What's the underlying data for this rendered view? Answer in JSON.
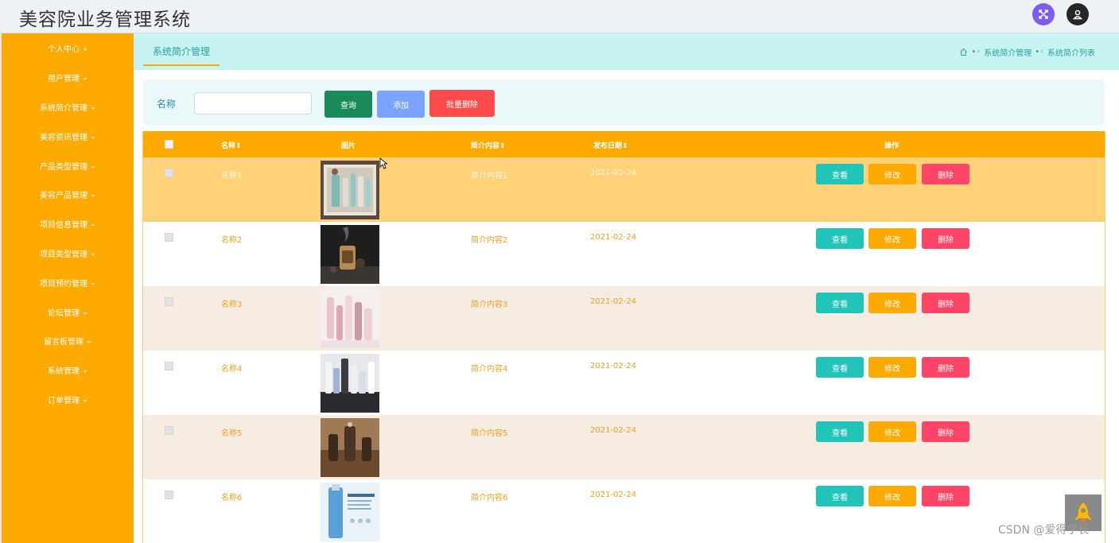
{
  "app": {
    "title": "美容院业务管理系统"
  },
  "header": {
    "icons": [
      "expand-icon",
      "user-avatar-icon"
    ]
  },
  "sidebar": {
    "items": [
      {
        "label": "个人中心"
      },
      {
        "label": "用户管理"
      },
      {
        "label": "系统简介管理"
      },
      {
        "label": "美容资讯管理"
      },
      {
        "label": "产品类型管理"
      },
      {
        "label": "美容产品管理"
      },
      {
        "label": "项目信息管理"
      },
      {
        "label": "项目类型管理"
      },
      {
        "label": "项目预约管理"
      },
      {
        "label": "论坛管理"
      },
      {
        "label": "留言板管理"
      },
      {
        "label": "系统管理"
      },
      {
        "label": "订单管理"
      }
    ]
  },
  "breadcrumb": {
    "tab": "系统简介管理",
    "path": [
      "系统简介管理",
      "系统简介列表"
    ]
  },
  "search": {
    "label": "名称",
    "value": "",
    "query_btn": "查询",
    "add_btn": "添加",
    "batch_delete_btn": "批量删除"
  },
  "table": {
    "headers": {
      "name": "名称",
      "image": "图片",
      "content": "简介内容",
      "date": "发布日期",
      "actions": "操作"
    },
    "sort_glyph": "⇕",
    "rows": [
      {
        "name": "名称1",
        "content": "简介内容1",
        "date": "2021-02-24",
        "image": "cosmetics-tray"
      },
      {
        "name": "名称2",
        "content": "简介内容2",
        "date": "2021-02-24",
        "image": "aroma-diffuser"
      },
      {
        "name": "名称3",
        "content": "简介内容3",
        "date": "2021-02-24",
        "image": "pink-bottles"
      },
      {
        "name": "名称4",
        "content": "简介内容4",
        "date": "2021-02-24",
        "image": "skincare-set"
      },
      {
        "name": "名称5",
        "content": "简介内容5",
        "date": "2021-02-24",
        "image": "wooden-diffusers"
      },
      {
        "name": "名称6",
        "content": "简介内容6",
        "date": "2021-02-24",
        "image": "serum-bottle"
      }
    ],
    "row_actions": {
      "view": "查看",
      "edit": "修改",
      "delete": "删除"
    }
  },
  "watermark": "CSDN @爱得学长",
  "colors": {
    "sidebar": "#ffaa00",
    "crumbbar": "#c8f3f3",
    "row_highlight": "#ffd27a",
    "row_alt": "#f6ece2"
  }
}
